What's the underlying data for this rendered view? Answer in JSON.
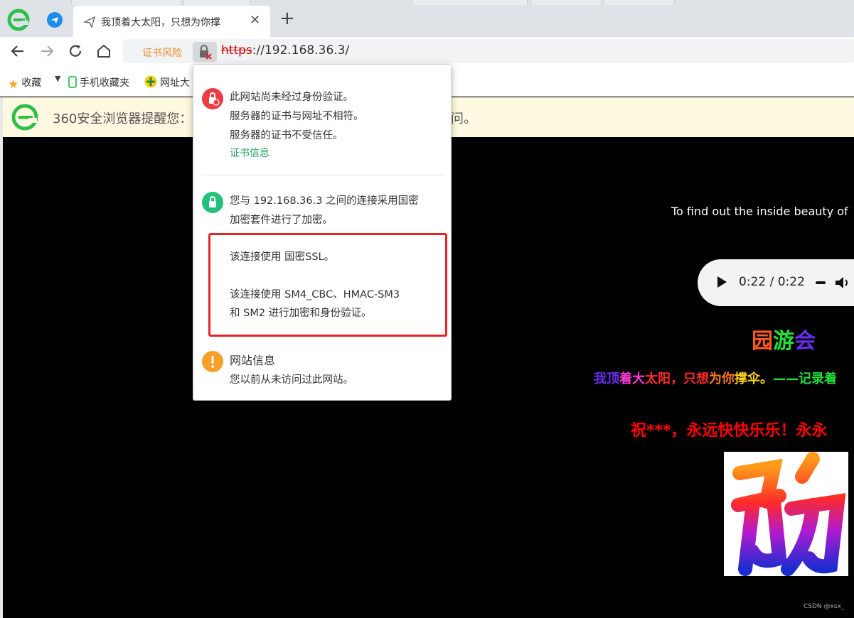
{
  "tab": {
    "title": "我顶着大太阳，只想为你撑"
  },
  "address": {
    "cert_risk": "证书风险",
    "scheme": "https",
    "rest": "://192.168.36.3/"
  },
  "bookmarks": [
    "收藏",
    "手机收藏夹",
    "网址大"
  ],
  "warning": {
    "text": "360安全浏览器提醒您：",
    "tail": "问。"
  },
  "popup": {
    "unverified": [
      "此网站尚未经过身份验证。",
      "服务器的证书与网址不相符。",
      "服务器的证书不受信任。"
    ],
    "cert_info_link": "证书信息",
    "encrypted": [
      "您与 192.168.36.3 之间的连接采用国密",
      "加密套件进行了加密。"
    ],
    "ssl": "该连接使用 国密SSL。",
    "algo": [
      "该连接使用 SM4_CBC、HMAC-SM3",
      "和 SM2 进行加密和身份验证。"
    ],
    "site_info_title": "网站信息",
    "site_info_desc": "您以前从未访问过此网站。"
  },
  "page": {
    "tagline": "To find out the inside beauty of",
    "audio_time": "0:22 / 0:22",
    "title_parts": [
      "园",
      "游",
      "会"
    ],
    "rainbow_text": [
      {
        "t": "我顶",
        "c": "#6a2cf2"
      },
      {
        "t": "着大",
        "c": "#ff3ad8"
      },
      {
        "t": "太阳，",
        "c": "#ff2a2a"
      },
      {
        "t": "只想",
        "c": "#ff2a2a"
      },
      {
        "t": "为你",
        "c": "#ff7a1a"
      },
      {
        "t": "撑伞。",
        "c": "#ffd21a"
      },
      {
        "t": "——记录着",
        "c": "#22e03a"
      }
    ],
    "wish": "祝***，永远快快乐乐！永永",
    "watermark": "CSDN @xsx_"
  },
  "colors": {
    "risk": "#f08a24",
    "link_green": "#25a55f",
    "alert_red": "#e5232a"
  }
}
